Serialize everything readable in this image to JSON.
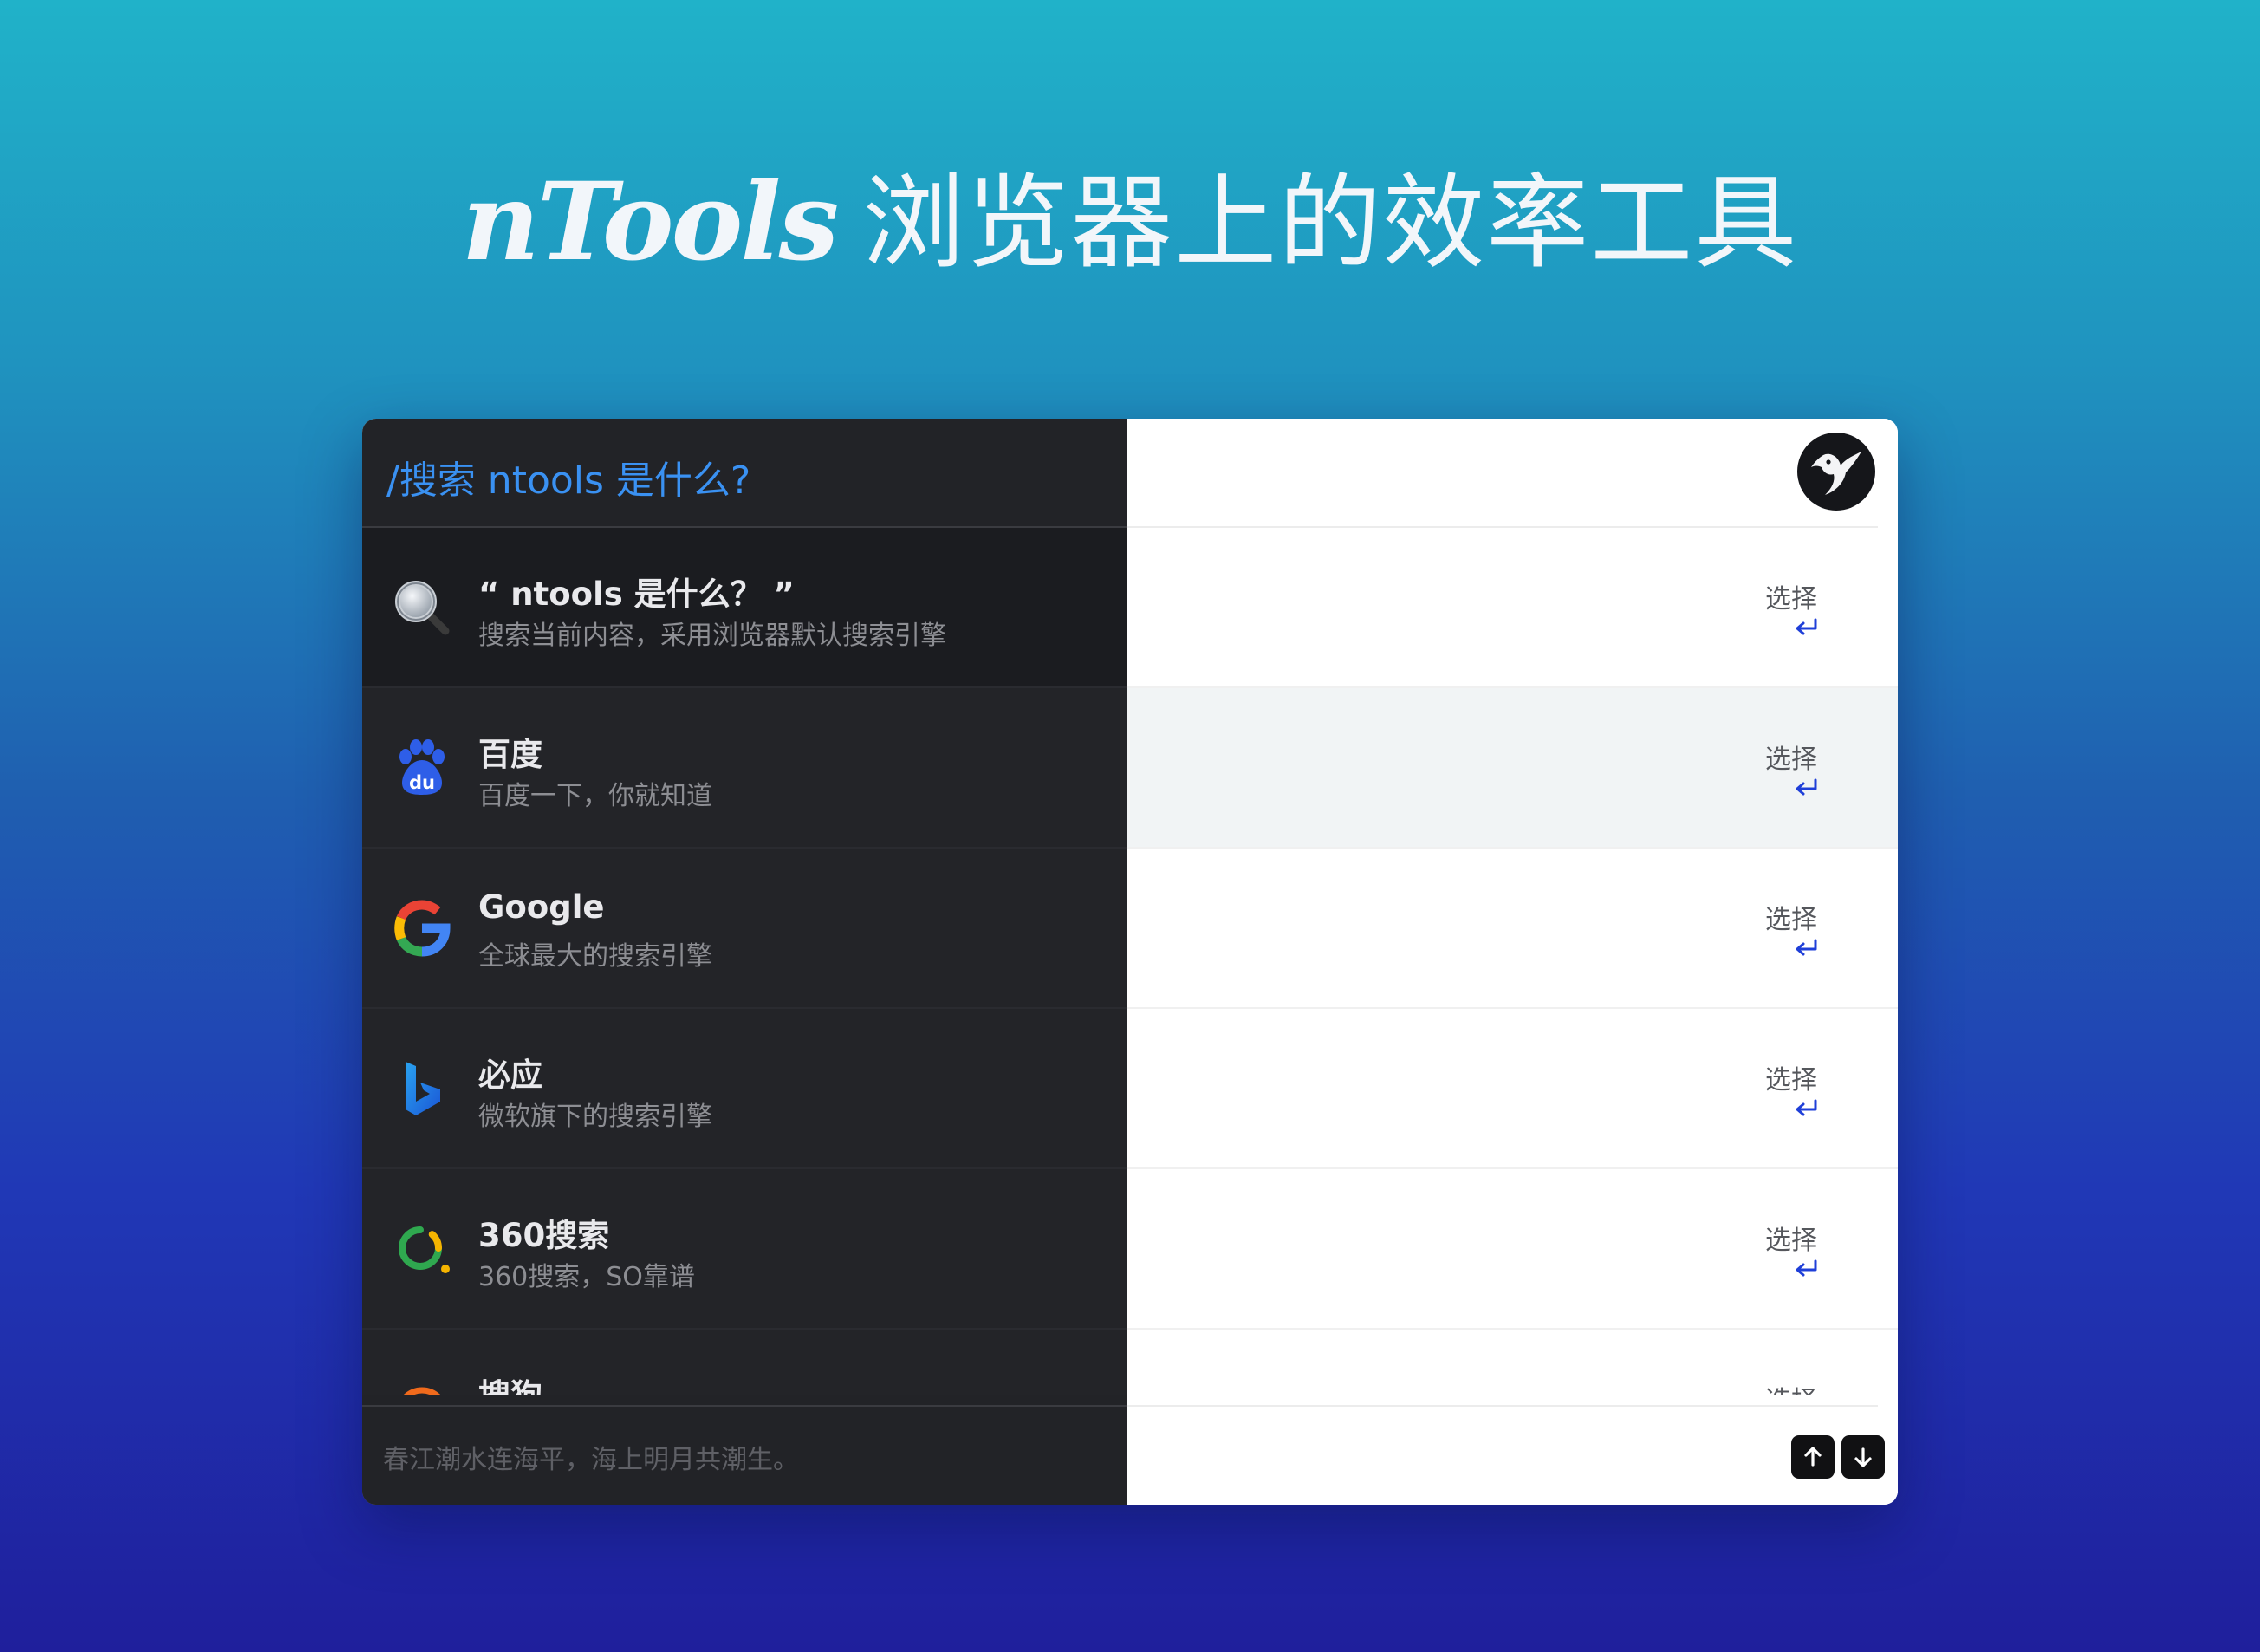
{
  "header": {
    "brand": "nTools",
    "tagline": "浏览器上的效率工具"
  },
  "search": {
    "query": "/搜索 ntools 是什么?"
  },
  "results": [
    {
      "title": "“ ntools 是什么？ ”",
      "desc": "搜索当前内容，采用浏览器默认搜索引擎",
      "icon": "magnifier-icon",
      "select_label": "选择"
    },
    {
      "title": "百度",
      "desc": "百度一下，你就知道",
      "icon": "baidu-icon",
      "select_label": "选择"
    },
    {
      "title": "Google",
      "desc": "全球最大的搜索引擎",
      "icon": "google-icon",
      "select_label": "选择"
    },
    {
      "title": "必应",
      "desc": "微软旗下的搜索引擎",
      "icon": "bing-icon",
      "select_label": "选择"
    },
    {
      "title": "360搜索",
      "desc": "360搜索，SO靠谱",
      "icon": "so360-icon",
      "select_label": "选择"
    },
    {
      "title": "搜狗",
      "desc": "",
      "icon": "sogou-icon",
      "select_label": "选择"
    }
  ],
  "footer": {
    "poem": "春江潮水连海平，海上明月共潮生。"
  },
  "colors": {
    "accent": "#3a91f2",
    "left_pane": "#222327",
    "hover_row": "#f1f4f5",
    "enter_icon": "#1f3fd8"
  }
}
